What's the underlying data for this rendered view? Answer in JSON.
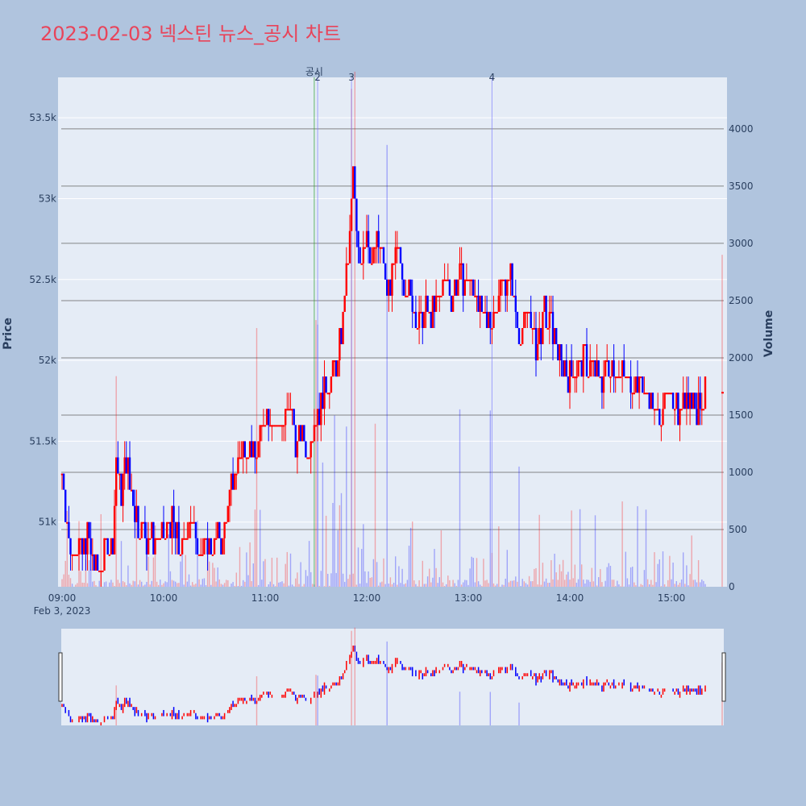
{
  "title": "2023-02-03 넥스틴 뉴스_공시 차트",
  "colors": {
    "background": "#b0c4de",
    "plot_bg": "#e5ecf6",
    "up": "#ff0000",
    "down": "#0000ff",
    "title": "#e8445a",
    "vol_grid": "#6b6b6b",
    "price_grid": "#ffffff",
    "disclosure_line": "#2ca02c",
    "news_line": "#7f7fff"
  },
  "chart_data": {
    "type": "candlestick",
    "title": "2023-02-03 넥스틴 뉴스_공시 차트",
    "ylabel": "Price",
    "y2label": "Volume",
    "ylim": [
      50600,
      53750
    ],
    "y2lim": [
      0,
      4450
    ],
    "price_ticks": [
      {
        "v": 51000,
        "label": "51k"
      },
      {
        "v": 51500,
        "label": "51.5k"
      },
      {
        "v": 52000,
        "label": "52k"
      },
      {
        "v": 52500,
        "label": "52.5k"
      },
      {
        "v": 53000,
        "label": "53k"
      },
      {
        "v": 53500,
        "label": "53.5k"
      }
    ],
    "volume_ticks": [
      {
        "v": 0,
        "label": "0"
      },
      {
        "v": 500,
        "label": "500"
      },
      {
        "v": 1000,
        "label": "1000"
      },
      {
        "v": 1500,
        "label": "1500"
      },
      {
        "v": 2000,
        "label": "2000"
      },
      {
        "v": 2500,
        "label": "2500"
      },
      {
        "v": 3000,
        "label": "3000"
      },
      {
        "v": 3500,
        "label": "3500"
      },
      {
        "v": 4000,
        "label": "4000"
      }
    ],
    "x_range": [
      "09:00",
      "15:30"
    ],
    "time_ticks": [
      {
        "t": "09:00",
        "label": "09:00",
        "sub": "Feb 3, 2023"
      },
      {
        "t": "10:00",
        "label": "10:00"
      },
      {
        "t": "11:00",
        "label": "11:00"
      },
      {
        "t": "12:00",
        "label": "12:00"
      },
      {
        "t": "13:00",
        "label": "13:00"
      },
      {
        "t": "14:00",
        "label": "14:00"
      },
      {
        "t": "15:00",
        "label": "15:00"
      }
    ],
    "annotations": [
      {
        "t": "11:29",
        "label": "공시",
        "kind": "disclosure"
      },
      {
        "t": "11:31",
        "label": "2",
        "kind": "news"
      },
      {
        "t": "11:51",
        "label": "3",
        "kind": "news"
      },
      {
        "t": "13:14",
        "label": "4",
        "kind": "news"
      }
    ],
    "price_path": [
      [
        "09:00",
        51300
      ],
      [
        "09:02",
        51100
      ],
      [
        "09:05",
        50800
      ],
      [
        "09:08",
        50900
      ],
      [
        "09:12",
        50800
      ],
      [
        "09:15",
        50900
      ],
      [
        "09:20",
        50700
      ],
      [
        "09:25",
        50800
      ],
      [
        "09:30",
        50900
      ],
      [
        "09:32",
        51400
      ],
      [
        "09:35",
        51200
      ],
      [
        "09:38",
        51400
      ],
      [
        "09:42",
        51100
      ],
      [
        "09:45",
        51000
      ],
      [
        "09:50",
        50900
      ],
      [
        "09:55",
        50900
      ],
      [
        "10:00",
        50900
      ],
      [
        "10:05",
        51000
      ],
      [
        "10:10",
        50800
      ],
      [
        "10:15",
        51000
      ],
      [
        "10:20",
        50900
      ],
      [
        "10:25",
        50800
      ],
      [
        "10:30",
        50900
      ],
      [
        "10:35",
        50900
      ],
      [
        "10:40",
        51200
      ],
      [
        "10:45",
        51400
      ],
      [
        "10:50",
        51500
      ],
      [
        "10:55",
        51400
      ],
      [
        "11:00",
        51700
      ],
      [
        "11:05",
        51600
      ],
      [
        "11:10",
        51600
      ],
      [
        "11:15",
        51700
      ],
      [
        "11:18",
        51500
      ],
      [
        "11:22",
        51500
      ],
      [
        "11:25",
        51400
      ],
      [
        "11:28",
        51600
      ],
      [
        "11:32",
        51700
      ],
      [
        "11:35",
        51800
      ],
      [
        "11:40",
        51900
      ],
      [
        "11:43",
        52000
      ],
      [
        "11:46",
        52300
      ],
      [
        "11:48",
        52500
      ],
      [
        "11:50",
        52800
      ],
      [
        "11:52",
        53200
      ],
      [
        "11:54",
        52800
      ],
      [
        "11:56",
        52600
      ],
      [
        "11:58",
        52700
      ],
      [
        "12:00",
        52800
      ],
      [
        "12:03",
        52600
      ],
      [
        "12:06",
        52700
      ],
      [
        "12:10",
        52600
      ],
      [
        "12:12",
        52400
      ],
      [
        "12:15",
        52500
      ],
      [
        "12:18",
        52700
      ],
      [
        "12:22",
        52500
      ],
      [
        "12:25",
        52400
      ],
      [
        "12:30",
        52200
      ],
      [
        "12:35",
        52300
      ],
      [
        "12:40",
        52300
      ],
      [
        "12:45",
        52500
      ],
      [
        "12:50",
        52400
      ],
      [
        "12:55",
        52500
      ],
      [
        "13:00",
        52500
      ],
      [
        "13:05",
        52400
      ],
      [
        "13:10",
        52200
      ],
      [
        "13:15",
        52300
      ],
      [
        "13:20",
        52500
      ],
      [
        "13:25",
        52500
      ],
      [
        "13:30",
        52200
      ],
      [
        "13:35",
        52300
      ],
      [
        "13:40",
        52100
      ],
      [
        "13:45",
        52300
      ],
      [
        "13:50",
        52200
      ],
      [
        "13:55",
        52000
      ],
      [
        "14:00",
        51900
      ],
      [
        "14:05",
        52000
      ],
      [
        "14:10",
        52000
      ],
      [
        "14:15",
        51900
      ],
      [
        "14:20",
        51900
      ],
      [
        "14:25",
        52000
      ],
      [
        "14:30",
        51900
      ],
      [
        "14:35",
        51900
      ],
      [
        "14:40",
        51900
      ],
      [
        "14:45",
        51800
      ],
      [
        "14:50",
        51700
      ],
      [
        "14:55",
        51700
      ],
      [
        "15:00",
        51800
      ],
      [
        "15:05",
        51700
      ],
      [
        "15:10",
        51800
      ],
      [
        "15:15",
        51700
      ],
      [
        "15:20",
        51800
      ]
    ],
    "last_close": 51800,
    "volume_spikes": [
      {
        "t": "09:32",
        "v": 1840,
        "dir": "up"
      },
      {
        "t": "10:55",
        "v": 2260,
        "dir": "up"
      },
      {
        "t": "11:30",
        "v": 2330,
        "dir": "up"
      },
      {
        "t": "11:31",
        "v": 2290,
        "dir": "down"
      },
      {
        "t": "11:51",
        "v": 4350,
        "dir": "up"
      },
      {
        "t": "11:53",
        "v": 4500,
        "dir": "up"
      },
      {
        "t": "12:12",
        "v": 3860,
        "dir": "down"
      },
      {
        "t": "12:55",
        "v": 1550,
        "dir": "down"
      },
      {
        "t": "13:13",
        "v": 1540,
        "dir": "down"
      },
      {
        "t": "13:30",
        "v": 1050,
        "dir": "down"
      },
      {
        "t": "15:30",
        "v": 2900,
        "dir": "up"
      }
    ]
  }
}
